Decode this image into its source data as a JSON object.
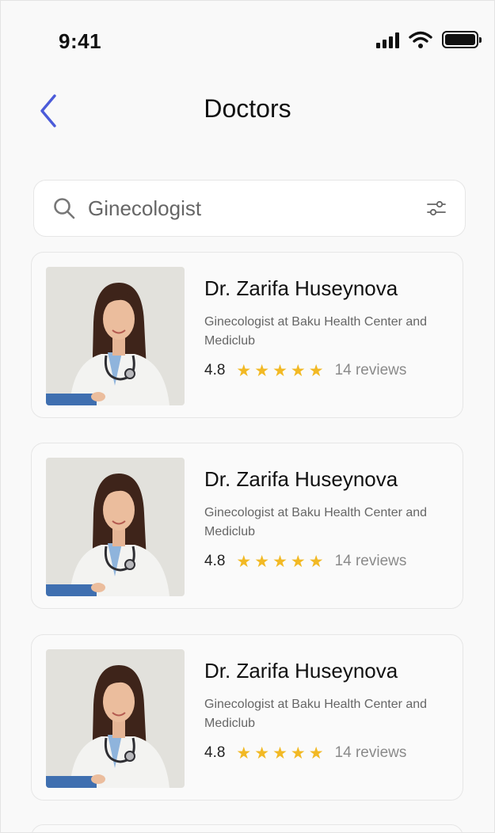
{
  "status_bar": {
    "time": "9:41"
  },
  "header": {
    "title": "Doctors"
  },
  "search": {
    "value": "Ginecologist"
  },
  "doctors": [
    {
      "name": "Dr. Zarifa Huseynova",
      "description": "Ginecologist at Baku Health Center and Mediclub",
      "rating": "4.8",
      "reviews": "14 reviews",
      "stars": 5
    },
    {
      "name": "Dr. Zarifa Huseynova",
      "description": "Ginecologist at Baku Health Center and Mediclub",
      "rating": "4.8",
      "reviews": "14 reviews",
      "stars": 5
    },
    {
      "name": "Dr. Zarifa Huseynova",
      "description": "Ginecologist at Baku Health Center and Mediclub",
      "rating": "4.8",
      "reviews": "14 reviews",
      "stars": 5
    }
  ],
  "colors": {
    "accent": "#4b5bd9",
    "star": "#f2b924",
    "photo_bg": "#e2e1dc"
  },
  "icons": [
    "back-chevron-icon",
    "search-icon",
    "filter-icon",
    "star-icon",
    "signal-icon",
    "wifi-icon",
    "battery-icon"
  ]
}
